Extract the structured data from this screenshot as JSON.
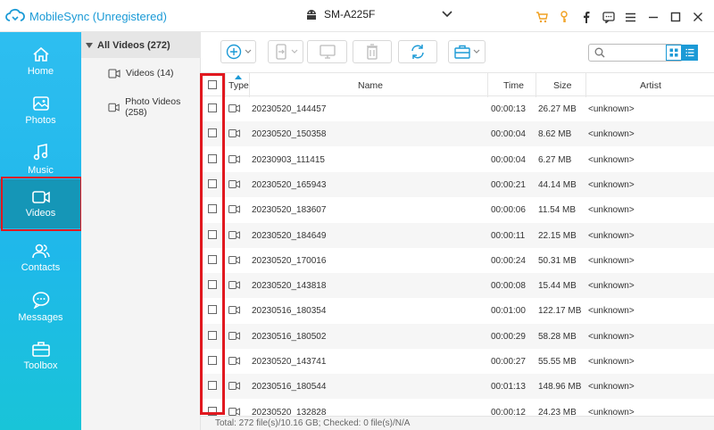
{
  "app": {
    "title": "MobileSync (Unregistered)",
    "device": "SM-A225F"
  },
  "nav": {
    "items": [
      {
        "label": "Home"
      },
      {
        "label": "Photos"
      },
      {
        "label": "Music"
      },
      {
        "label": "Videos"
      },
      {
        "label": "Contacts"
      },
      {
        "label": "Messages"
      },
      {
        "label": "Toolbox"
      }
    ],
    "active": "Videos"
  },
  "folders": {
    "header": "All Videos (272)",
    "items": [
      {
        "label": "Videos (14)"
      },
      {
        "label": "Photo Videos (258)"
      }
    ]
  },
  "table": {
    "columns": {
      "type": "Type",
      "name": "Name",
      "time": "Time",
      "size": "Size",
      "artist": "Artist"
    },
    "rows": [
      {
        "name": "20230520_144457",
        "time": "00:00:13",
        "size": "26.27 MB",
        "artist": "<unknown>"
      },
      {
        "name": "20230520_150358",
        "time": "00:00:04",
        "size": "8.62 MB",
        "artist": "<unknown>"
      },
      {
        "name": "20230903_111415",
        "time": "00:00:04",
        "size": "6.27 MB",
        "artist": "<unknown>"
      },
      {
        "name": "20230520_165943",
        "time": "00:00:21",
        "size": "44.14 MB",
        "artist": "<unknown>"
      },
      {
        "name": "20230520_183607",
        "time": "00:00:06",
        "size": "11.54 MB",
        "artist": "<unknown>"
      },
      {
        "name": "20230520_184649",
        "time": "00:00:11",
        "size": "22.15 MB",
        "artist": "<unknown>"
      },
      {
        "name": "20230520_170016",
        "time": "00:00:24",
        "size": "50.31 MB",
        "artist": "<unknown>"
      },
      {
        "name": "20230520_143818",
        "time": "00:00:08",
        "size": "15.44 MB",
        "artist": "<unknown>"
      },
      {
        "name": "20230516_180354",
        "time": "00:01:00",
        "size": "122.17 MB",
        "artist": "<unknown>"
      },
      {
        "name": "20230516_180502",
        "time": "00:00:29",
        "size": "58.28 MB",
        "artist": "<unknown>"
      },
      {
        "name": "20230520_143741",
        "time": "00:00:27",
        "size": "55.55 MB",
        "artist": "<unknown>"
      },
      {
        "name": "20230516_180544",
        "time": "00:01:13",
        "size": "148.96 MB",
        "artist": "<unknown>"
      },
      {
        "name": "20230520_132828",
        "time": "00:00:12",
        "size": "24.23 MB",
        "artist": "<unknown>"
      }
    ]
  },
  "status": {
    "text": "Total: 272 file(s)/10.16 GB; Checked: 0 file(s)/N/A"
  },
  "colors": {
    "accent": "#1c9ad6",
    "nav_active": "#1596b7",
    "highlight": "#e1181f",
    "cart": "#f0a020"
  }
}
